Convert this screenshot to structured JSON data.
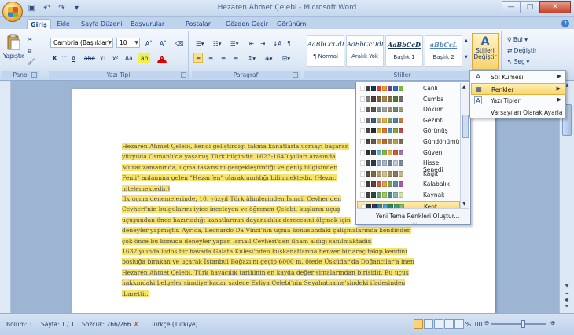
{
  "window": {
    "title": "Hezaren Ahmet Çelebi - Microsoft Word",
    "minimize": "—",
    "maximize": "□",
    "close": "✕"
  },
  "tabs": [
    {
      "label": "Giriş",
      "active": true
    },
    {
      "label": "Ekle"
    },
    {
      "label": "Sayfa Düzeni"
    },
    {
      "label": "Başvurular"
    },
    {
      "label": "Postalar"
    },
    {
      "label": "Gözden Geçir"
    },
    {
      "label": "Görünüm"
    }
  ],
  "ribbon": {
    "clipboard": {
      "label": "Pano",
      "paste": "Yapıştır"
    },
    "font": {
      "label": "Yazı Tipi",
      "font_name": "Cambria (Başlıklar)",
      "font_size": "10",
      "bold": "K",
      "italic": "T",
      "underline": "A",
      "strike": "abe",
      "sub": "x₂",
      "sup": "x²",
      "case": "Aa",
      "grow": "A˄",
      "shrink": "A˅"
    },
    "paragraph": {
      "label": "Paragraf"
    },
    "styles": {
      "label": "Stiller",
      "items": [
        {
          "sample": "AaBbCcDdI",
          "name": "¶ Normal"
        },
        {
          "sample": "AaBbCcDdI",
          "name": "Aralık Yok"
        },
        {
          "sample": "AaBbCcD",
          "name": "Başlık 1"
        },
        {
          "sample": "aBbCcL",
          "name": "Başlık 2"
        }
      ],
      "change_styles": "Stilleri Değiştir"
    },
    "editing": {
      "find": "Bul",
      "replace": "Değiştir",
      "select": "Seç"
    }
  },
  "menu": {
    "items": [
      {
        "label": "Stil Kümesi",
        "icon": "A"
      },
      {
        "label": "Renkler",
        "icon": "▦",
        "hot": true
      },
      {
        "label": "Yazı Tipleri",
        "icon": "A"
      },
      {
        "label": "Varsayılan Olarak Ayarla",
        "icon": ""
      }
    ]
  },
  "gallery": {
    "items": [
      {
        "name": "Canlı",
        "colors": [
          "#ffffff",
          "#3f3f3f",
          "#17365d",
          "#e43d2c",
          "#f39a28",
          "#6b3fa0",
          "#2e74b5",
          "#79b940"
        ]
      },
      {
        "name": "Cumba",
        "colors": [
          "#ffffff",
          "#7f7f7f",
          "#4f3e33",
          "#7d5e3b",
          "#b38a4e",
          "#8a6d3b",
          "#5a7a3a",
          "#6d6d6d"
        ]
      },
      {
        "name": "Döküm",
        "colors": [
          "#ffffff",
          "#5f5f5f",
          "#5b524a",
          "#7e8a8a",
          "#a3a3a3",
          "#968c6d",
          "#6e8a6b",
          "#a3987a"
        ]
      },
      {
        "name": "Gezinti",
        "colors": [
          "#ffffff",
          "#6a6a6a",
          "#3f5a7a",
          "#b7a46b",
          "#e5ad4f",
          "#7a9c5b",
          "#5781b0",
          "#c07b4a"
        ]
      },
      {
        "name": "Görünüş",
        "colors": [
          "#ffffff",
          "#444444",
          "#2b2b2b",
          "#d4b230",
          "#e4791f",
          "#4a88c9",
          "#89a53e",
          "#b64c4c"
        ]
      },
      {
        "name": "Gündönümü",
        "colors": [
          "#ffffff",
          "#4a3d31",
          "#6a5a45",
          "#d99a3a",
          "#c56b2a",
          "#9b8a52",
          "#b8a54b",
          "#7a6b4d"
        ]
      },
      {
        "name": "Güven",
        "colors": [
          "#ffffff",
          "#2f2f2f",
          "#38444e",
          "#5ab3c7",
          "#8fb24a",
          "#e3ab3c",
          "#d2593a",
          "#9a73b8"
        ]
      },
      {
        "name": "Hisse Senedi",
        "colors": [
          "#ffffff",
          "#4a4a4a",
          "#2f3b4b",
          "#8ea6c7",
          "#a9b6c8",
          "#6c7e93",
          "#c3cbd6",
          "#7a8b9d"
        ]
      },
      {
        "name": "Kağıt",
        "colors": [
          "#ffffff",
          "#5a4b3f",
          "#846a4b",
          "#b49d6b",
          "#d6c08c",
          "#a8875a",
          "#8f7a5b",
          "#c9b38f"
        ]
      },
      {
        "name": "Kalabalık",
        "colors": [
          "#ffffff",
          "#3b3b3b",
          "#6c3b3b",
          "#c75b4a",
          "#e0a34a",
          "#8a9d4f",
          "#5e8fb5",
          "#a55ca0"
        ]
      },
      {
        "name": "Kaynak",
        "colors": [
          "#ffffff",
          "#404040",
          "#2d4a3b",
          "#6aa267",
          "#a6c957",
          "#3f8c8c",
          "#8ab4b0",
          "#cfe0a0"
        ]
      },
      {
        "name": "Kent",
        "colors": [
          "#ffffff",
          "#333333",
          "#2c3e50",
          "#2f86b9",
          "#4fa3d3",
          "#2e8b57",
          "#4aa06b",
          "#7fbf6f"
        ],
        "selected": true
      }
    ],
    "footer": "Yeni Tema Renkleri Oluştur..."
  },
  "document": {
    "paragraphs": [
      "Hezaren Ahmet Çelebi, kendi geliştirdiği takma kanatlarla uçmayı başaran",
      "yüzyılda Osmanlı'da yaşamış Türk bilgindir. 1623-1640 yılları arasında",
      "Murat zamanında, uçma tasarısını gerçekleştirdiği ve geniş bilgisinden",
      "Fenli\" anlamına gelen \"Hezarfen\" olarak anıldığı bilinmektedir. (Hezar,",
      "nitelemektedir.)",
      "İlk uçma denemelerinde, 10. yüzyıl Türk âlimlerinden İsmail Cevher'den",
      "Cevheri'nin bulgularını iyice inceleyen ve öğrenen Çelebi, kuşların uçuş",
      "uçuşundan önce hazırladığı kanatlarının dayanıklılık derecesini ölçmek için",
      "deneyler yapmıştır. Ayrıca, Leonardo Da Vinci'nin uçma konusundaki çalışmalarında kendinden",
      "çok önce bu konuda deneyler yapan İsmail Cevheri'den ilham aldığı sanılmaktadır.",
      "1632 yılında lodos bir havada Galata Kulesi'nden kuşkanatlarına benzer bir araç takıp kendini",
      "boşluğa bırakan ve uçarak İstanbul Boğazı'nı geçip 6000 m. ötede Üsküdar'da Doğancılar'a inen",
      "Hezaren Ahmet Çelebi, Türk havacılık tarihinin en kayda değer simalarından birisidir. Bu uçuş",
      "hakkındaki belgeler şimdiye kadar sadece Evliya Çelebi'nin Seyahatname'sindeki ifadesinden",
      "ibarettir."
    ]
  },
  "statusbar": {
    "section": "Bölüm: 1",
    "page": "Sayfa: 1 / 1",
    "words": "Sözcük: 266/266",
    "language": "Türkçe (Türkiye)",
    "zoom": "%100"
  }
}
